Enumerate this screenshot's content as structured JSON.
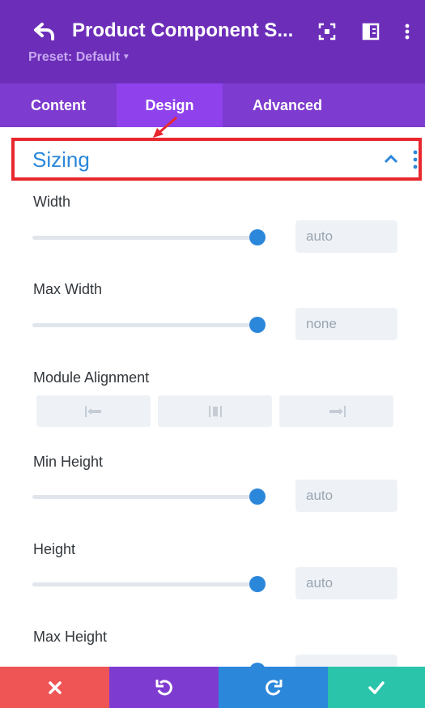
{
  "header": {
    "title": "Product Component S...",
    "preset_label": "Preset: Default",
    "colors": {
      "bg": "#6c2eb9",
      "preset": "#c7a8f0"
    }
  },
  "tabs": [
    {
      "label": "Content",
      "active": false
    },
    {
      "label": "Design",
      "active": true
    },
    {
      "label": "Advanced",
      "active": false
    }
  ],
  "section": {
    "title": "Sizing",
    "highlight_color": "#e8282e",
    "accent_color": "#2b87da"
  },
  "fields": {
    "width": {
      "label": "Width",
      "value": "auto",
      "level": 1.0
    },
    "max_width": {
      "label": "Max Width",
      "value": "none",
      "level": 1.0
    },
    "module_alignment": {
      "label": "Module Alignment",
      "options": [
        "align-left-icon",
        "align-center-icon",
        "align-right-icon"
      ]
    },
    "min_height": {
      "label": "Min Height",
      "value": "auto",
      "level": 1.0
    },
    "height": {
      "label": "Height",
      "value": "auto",
      "level": 1.0
    },
    "max_height": {
      "label": "Max Height"
    }
  },
  "footer": {
    "buttons": [
      {
        "icon": "close-icon",
        "color": "#ef5555"
      },
      {
        "icon": "undo-icon",
        "color": "#7e3bd0"
      },
      {
        "icon": "redo-icon",
        "color": "#2b87da"
      },
      {
        "icon": "check-icon",
        "color": "#29c4a9"
      }
    ]
  }
}
